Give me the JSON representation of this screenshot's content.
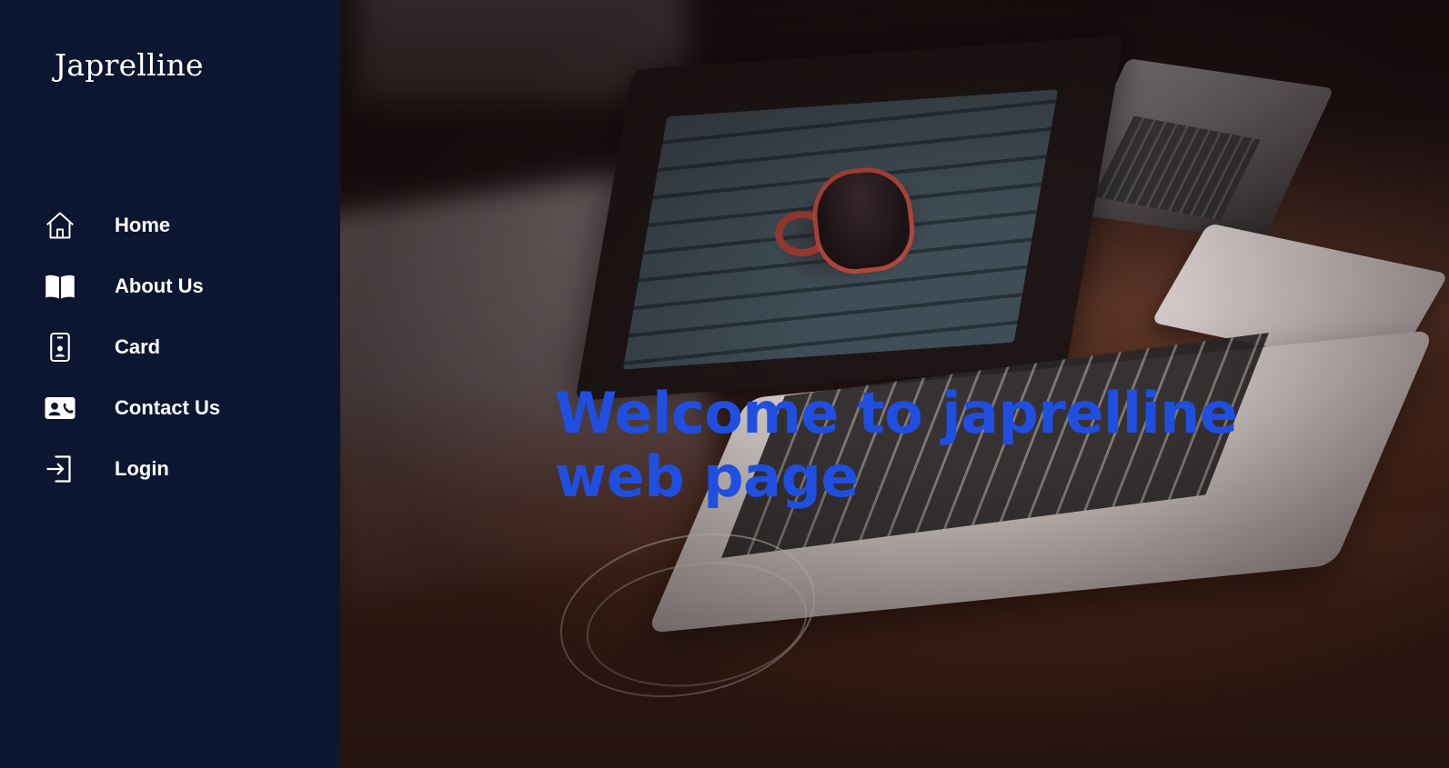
{
  "brand": {
    "name": "Japrelline"
  },
  "sidebar": {
    "items": [
      {
        "label": "Home",
        "icon": "home-icon"
      },
      {
        "label": "About Us",
        "icon": "book-icon"
      },
      {
        "label": "Card",
        "icon": "id-card-icon"
      },
      {
        "label": "Contact Us",
        "icon": "contact-card-icon"
      },
      {
        "label": "Login",
        "icon": "login-icon"
      }
    ]
  },
  "hero": {
    "title": "Welcome to japrelline web page"
  },
  "colors": {
    "sidebar_bg": "#0d1630",
    "sidebar_text": "#ffffff",
    "hero_title": "#1f4fe0"
  }
}
